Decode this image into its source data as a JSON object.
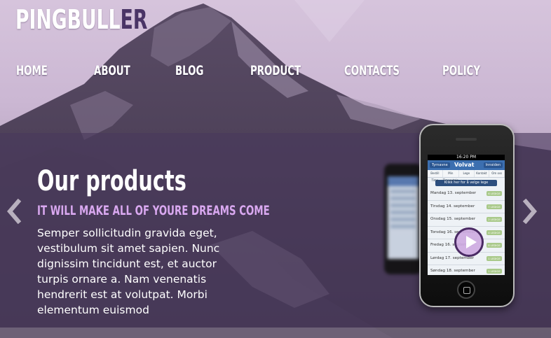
{
  "logo": {
    "main": "PINGBULL",
    "accent": "ER"
  },
  "nav": [
    "HOME",
    "ABOUT",
    "BLOG",
    "PRODUCT",
    "CONTACTS",
    "POLICY"
  ],
  "slide": {
    "heading": "Our products",
    "tagline": "IT WILL MAKE ALL OF YOURE DREAMS COME",
    "body": "Semper sollicitudin gravida eget, vestibulum sit amet sapien. Nunc dignissim tincidunt est, et auctor turpis ornare a. Nam venenatis hendrerit est at volutpat. Morbi elementum euismod"
  },
  "phone": {
    "time": "16:20 PM",
    "left_button": "Tyrnavne",
    "right_button": "Innsiden",
    "brand": "Volvat",
    "tabs": [
      "Bestill Time",
      "Min Timeavtale",
      "Lege",
      "Kontakt",
      "Om oss"
    ],
    "chooser": "Klikk her for å velge lege",
    "rows": [
      {
        "date": "Mandag 13. september",
        "badge": "6 LEDIGE"
      },
      {
        "date": "Tirsdag 14. september",
        "badge": "7 LEDIGE"
      },
      {
        "date": "Onsdag 15. september",
        "badge": "2 LEDIGE"
      },
      {
        "date": "Torsdag 16. september",
        "badge": "4 LEDIGE"
      },
      {
        "date": "Fredag 16. september",
        "badge": "8 LEDIGE"
      },
      {
        "date": "Lørdag 17. september",
        "badge": "1 LEDIGE"
      },
      {
        "date": "Søndag 18. september",
        "badge": "1 LEDIGE"
      }
    ]
  },
  "colors": {
    "accent": "#4a3466",
    "tagline": "#d9a8f0",
    "band": "#48385c"
  },
  "icons": {
    "prev": "chevron-left-icon",
    "next": "chevron-right-icon",
    "play": "play-icon"
  }
}
